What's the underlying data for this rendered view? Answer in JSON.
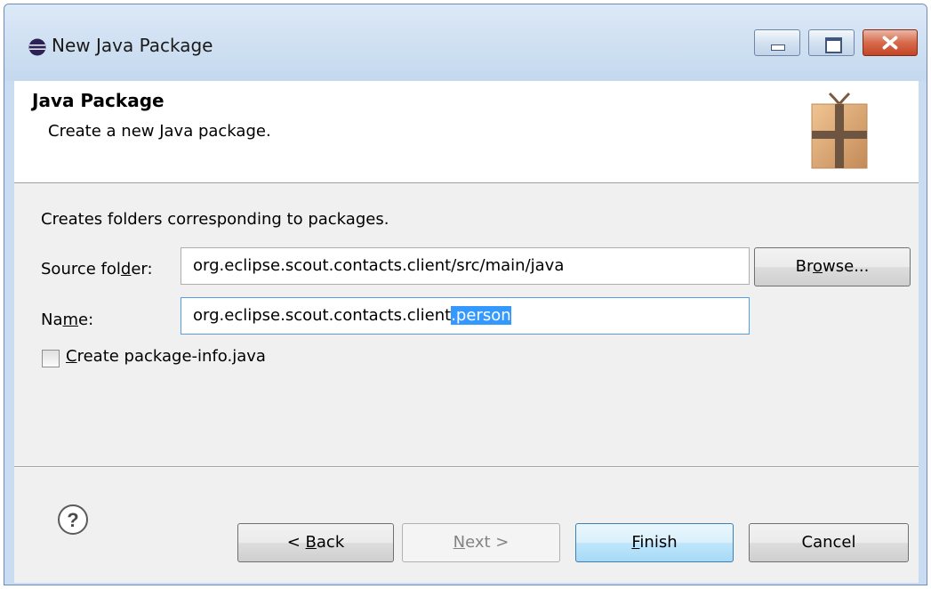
{
  "window": {
    "title": "New Java Package"
  },
  "header": {
    "title": "Java Package",
    "description": "Create a new Java package."
  },
  "form": {
    "info": "Creates folders corresponding to packages.",
    "source_folder": {
      "label_pre": "Source fol",
      "label_mnemonic": "d",
      "label_post": "er:",
      "value": "org.eclipse.scout.contacts.client/src/main/java"
    },
    "browse": {
      "pre": "Br",
      "mnemonic": "o",
      "post": "wse..."
    },
    "name": {
      "label_pre": "Na",
      "label_mnemonic": "m",
      "label_post": "e:",
      "value_unselected": "org.eclipse.scout.contacts.client",
      "value_selected": ".person"
    },
    "create_package_info": {
      "mnemonic": "C",
      "label_rest": "reate package-info.java",
      "checked": false
    }
  },
  "footer": {
    "back": {
      "pre": "< ",
      "mnemonic": "B",
      "post": "ack"
    },
    "next": {
      "mnemonic": "N",
      "post": "ext >"
    },
    "finish": {
      "mnemonic": "F",
      "post": "inish"
    },
    "cancel": "Cancel",
    "help_icon": "question-circle-icon"
  },
  "colors": {
    "selection": "#3399ff",
    "titlebar": "#c4d8ee",
    "close_button": "#c44526"
  }
}
